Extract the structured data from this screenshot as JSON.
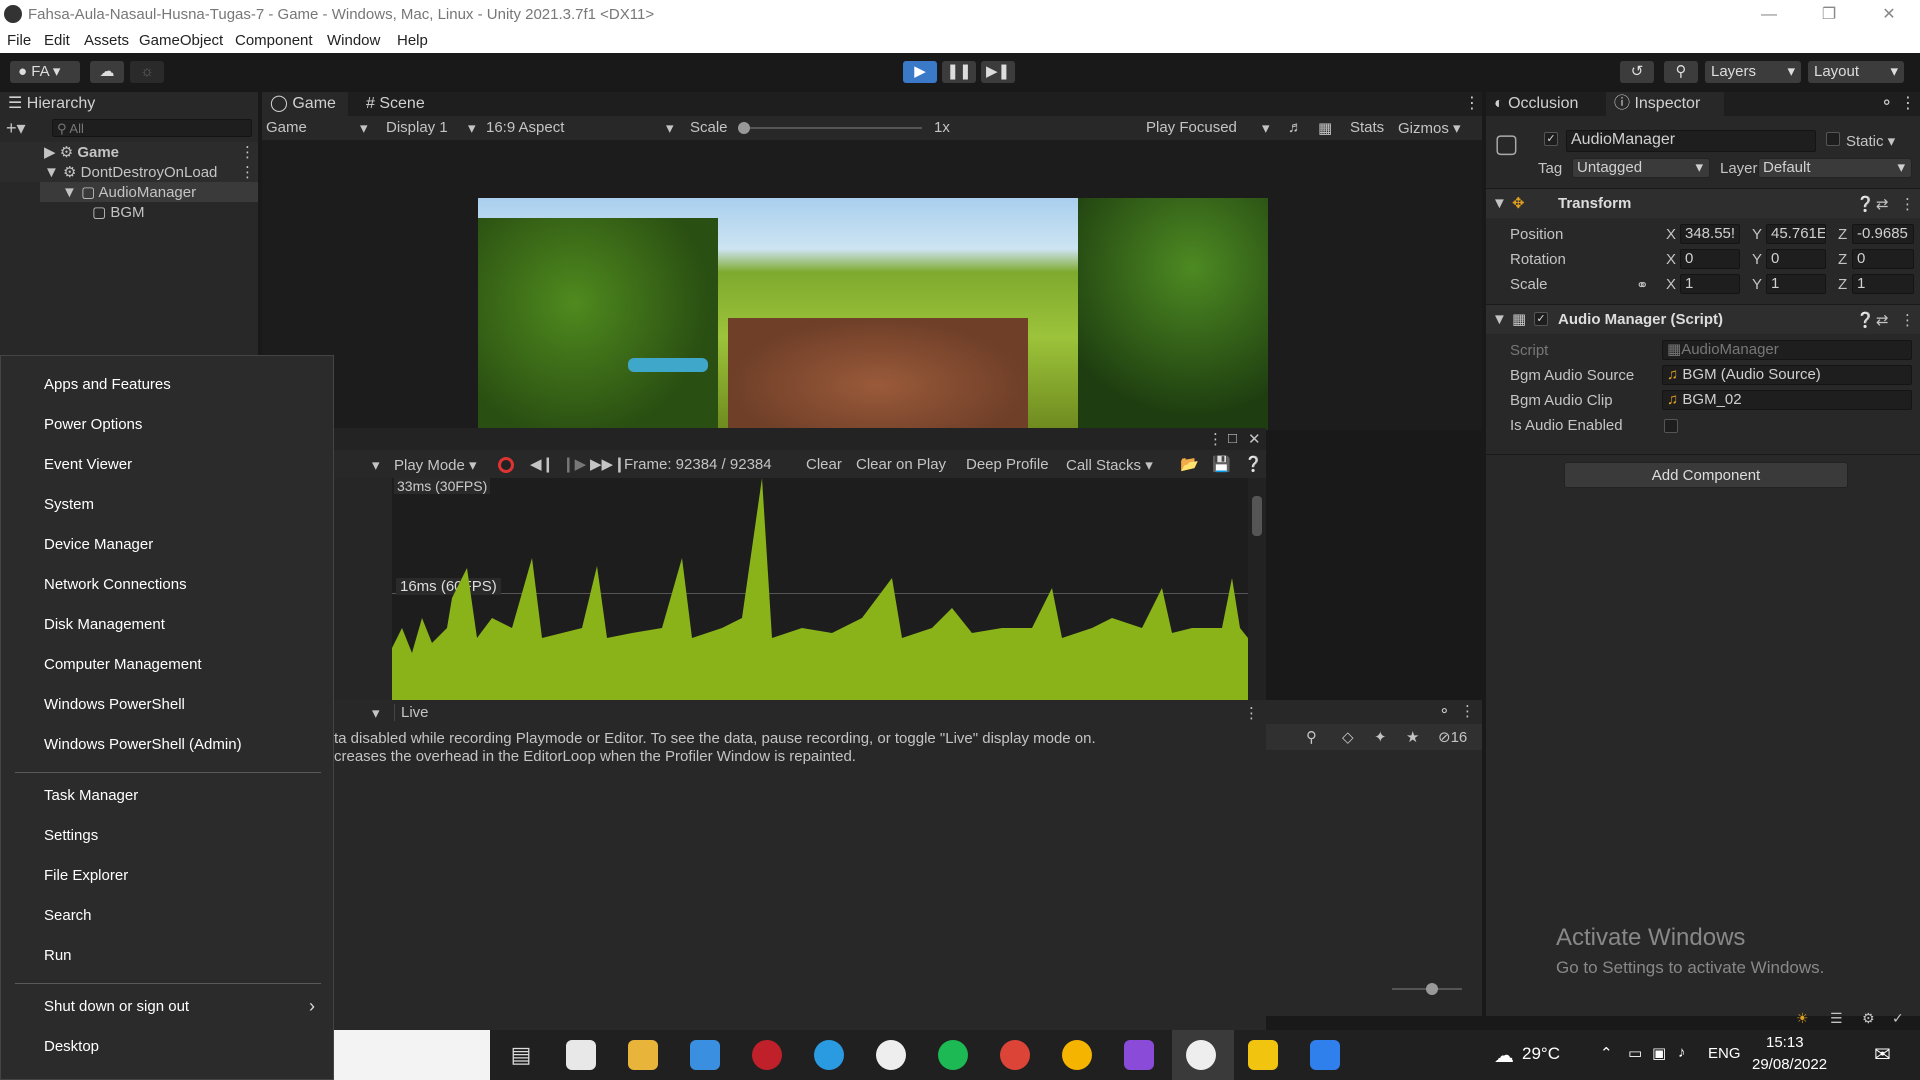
{
  "window": {
    "title": "Fahsa-Aula-Nasaul-Husna-Tugas-7 - Game - Windows, Mac, Linux - Unity 2021.3.7f1 <DX11>"
  },
  "menu": [
    "File",
    "Edit",
    "Assets",
    "GameObject",
    "Component",
    "Window",
    "Help"
  ],
  "toolbar": {
    "account": "FA",
    "layers": "Layers",
    "layout": "Layout"
  },
  "hierarchy": {
    "tab": "Hierarchy",
    "search_placeholder": "All",
    "items": [
      {
        "label": "Game"
      },
      {
        "label": "DontDestroyOnLoad"
      },
      {
        "label": "AudioManager"
      },
      {
        "label": "BGM"
      }
    ]
  },
  "game": {
    "tabs": [
      "Game",
      "Scene"
    ],
    "display_mode": "Game",
    "display": "Display 1",
    "aspect": "16:9 Aspect",
    "scale_label": "Scale",
    "scale_value": "1x",
    "play_focused": "Play Focused",
    "stats": "Stats",
    "gizmos": "Gizmos"
  },
  "profiler": {
    "play_mode": "Play Mode",
    "frame": "Frame: 92384 / 92384",
    "clear": "Clear",
    "clear_on_play": "Clear on Play",
    "deep_profile": "Deep Profile",
    "call_stacks": "Call Stacks",
    "top_marker": "33ms (30FPS)",
    "marker": "16ms (60FPS)",
    "live": "Live",
    "msg1": "ta disabled while recording Playmode or Editor. To see the data, pause recording, or toggle \"Live\" display mode on.",
    "msg2": "creases the overhead in the EditorLoop when the Profiler Window is repainted.",
    "hidden_count": "16"
  },
  "inspector": {
    "tabs": [
      "Occlusion",
      "Inspector"
    ],
    "object_name": "AudioManager",
    "static": "Static",
    "tag_label": "Tag",
    "tag": "Untagged",
    "layer_label": "Layer",
    "layer": "Default",
    "transform": {
      "title": "Transform",
      "position_label": "Position",
      "rotation_label": "Rotation",
      "scale_label": "Scale",
      "position": [
        "348.55!",
        "45.761E",
        "-0.9685"
      ],
      "rotation": [
        "0",
        "0",
        "0"
      ],
      "scale": [
        "1",
        "1",
        "1"
      ],
      "axes": [
        "X",
        "Y",
        "Z"
      ]
    },
    "script_comp": {
      "title": "Audio Manager (Script)",
      "script_label": "Script",
      "script_value": "AudioManager",
      "bgm_source_label": "Bgm Audio Source",
      "bgm_source_value": "BGM (Audio Source)",
      "bgm_clip_label": "Bgm Audio Clip",
      "bgm_clip_value": "BGM_02",
      "audio_enabled_label": "Is Audio Enabled"
    },
    "add_component": "Add Component",
    "watermark_title": "Activate Windows",
    "watermark_sub": "Go to Settings to activate Windows."
  },
  "start_menu": {
    "group1": [
      "Apps and Features",
      "Power Options",
      "Event Viewer",
      "System",
      "Device Manager",
      "Network Connections",
      "Disk Management",
      "Computer Management",
      "Windows PowerShell",
      "Windows PowerShell (Admin)"
    ],
    "group2": [
      "Task Manager",
      "Settings",
      "File Explorer",
      "Search",
      "Run"
    ],
    "group3": [
      "Shut down or sign out",
      "Desktop"
    ]
  },
  "taskbar": {
    "weather": "29°C",
    "lang": "ENG",
    "time": "15:13",
    "date": "29/08/2022"
  },
  "colors": {
    "accent": "#4a90d9",
    "profiler_green": "#8ab31a"
  }
}
